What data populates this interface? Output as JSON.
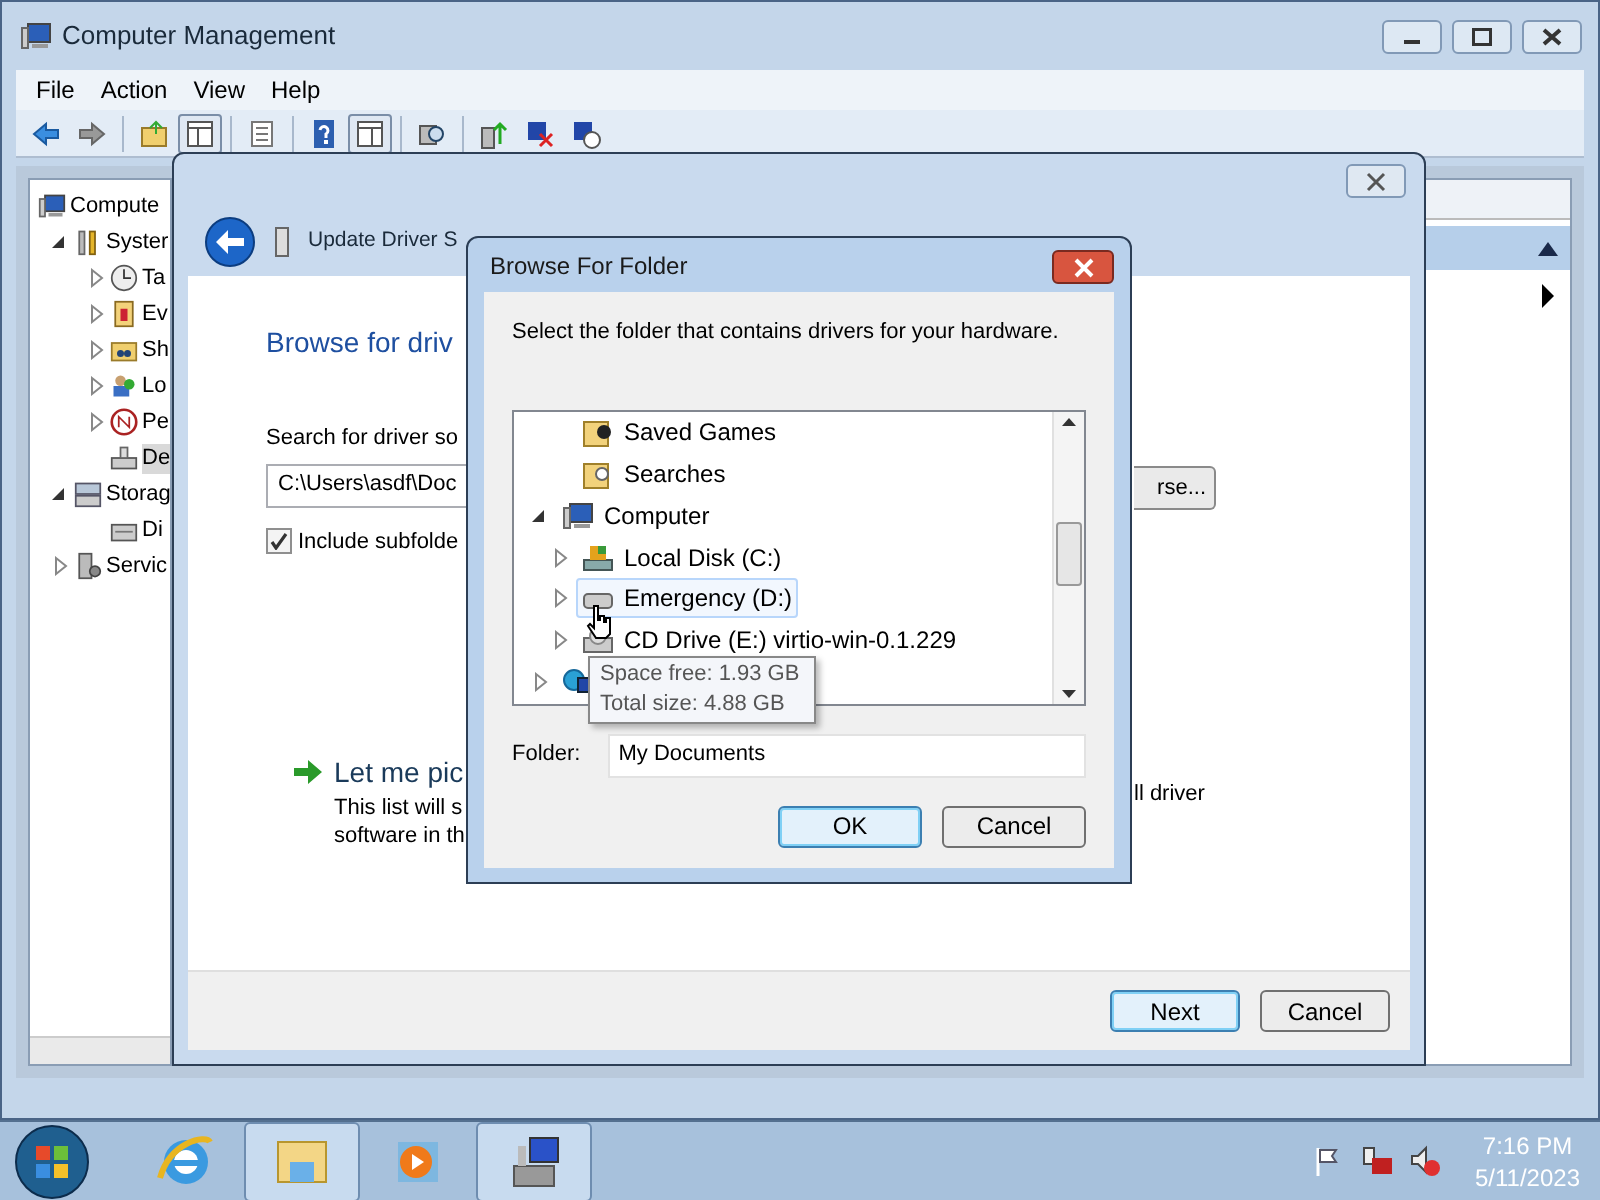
{
  "window": {
    "title": "Computer Management",
    "menu": [
      "File",
      "Action",
      "View",
      "Help"
    ]
  },
  "toolbar": [
    {
      "kind": "back"
    },
    {
      "kind": "forward"
    },
    {
      "kind": "sep"
    },
    {
      "kind": "up"
    },
    {
      "kind": "pane",
      "selected": true
    },
    {
      "kind": "sep"
    },
    {
      "kind": "list",
      "selected": false
    },
    {
      "kind": "sep"
    },
    {
      "kind": "help"
    },
    {
      "kind": "pane2",
      "selected": true
    },
    {
      "kind": "sep"
    },
    {
      "kind": "scan"
    },
    {
      "kind": "sep"
    },
    {
      "kind": "update"
    },
    {
      "kind": "remove"
    },
    {
      "kind": "install"
    }
  ],
  "tree": [
    {
      "label": "Compute",
      "kind": "computer",
      "selected": false,
      "children": [
        {
          "label": "Syster",
          "kind": "tools",
          "expanded": true,
          "selected": false,
          "children": [
            {
              "label": "Ta",
              "kind": "clock",
              "expanded": false,
              "selected": false
            },
            {
              "label": "Ev",
              "kind": "event",
              "expanded": false,
              "selected": false
            },
            {
              "label": "Sh",
              "kind": "share",
              "expanded": false,
              "selected": false
            },
            {
              "label": "Lo",
              "kind": "users",
              "expanded": false,
              "selected": false
            },
            {
              "label": "Pe",
              "kind": "perf",
              "expanded": false,
              "selected": false
            },
            {
              "label": "De",
              "kind": "device",
              "selected": true
            }
          ]
        },
        {
          "label": "Storag",
          "kind": "storage",
          "expanded": true,
          "selected": false,
          "children": [
            {
              "label": "Di",
              "kind": "disk",
              "selected": false
            }
          ]
        },
        {
          "label": "Servic",
          "kind": "services",
          "expanded": false,
          "selected": false
        }
      ]
    }
  ],
  "actions_panel": {
    "expanded": true
  },
  "wizard": {
    "title": "Update Driver S",
    "heading": "Browse for driv",
    "search_label": "Search for driver so",
    "path_value": "C:\\Users\\asdf\\Doc",
    "browse_button": "rse...",
    "include_subfolders": {
      "label": "Include subfolde",
      "checked": true
    },
    "pick_title": "Let me pic",
    "pick_desc": [
      "This list will s",
      "software in th"
    ],
    "pick_desc_tail": "ll driver",
    "buttons": [
      {
        "label": "Next",
        "default": true
      },
      {
        "label": "Cancel",
        "default": false
      }
    ]
  },
  "browse_dialog": {
    "title": "Browse For Folder",
    "prompt": "Select the folder that contains drivers for your hardware.",
    "tree": [
      {
        "label": "Saved Games",
        "kind": "saved-games",
        "hovered": false
      },
      {
        "label": "Searches",
        "kind": "searches",
        "hovered": false
      },
      {
        "label": "Computer",
        "kind": "computer",
        "expanded": true,
        "hovered": false,
        "children": [
          {
            "label": "Local Disk (C:)",
            "kind": "system-disk",
            "expanded": false,
            "hovered": false
          },
          {
            "label": "Emergency (D:)",
            "kind": "drive",
            "expanded": false,
            "hovered": true
          },
          {
            "label": "CD Drive (E:) virtio-win-0.1.229",
            "kind": "cd",
            "expanded": false,
            "hovered": false
          }
        ]
      },
      {
        "kind": "network",
        "expanded": false,
        "hovered": false
      }
    ],
    "tooltip": [
      "Space free: 1.93 GB",
      "Total size: 4.88 GB"
    ],
    "folder_label": "Folder:",
    "folder_value": "My Documents",
    "buttons": [
      {
        "label": "OK",
        "default": true
      },
      {
        "label": "Cancel",
        "default": false
      }
    ]
  },
  "taskbar": {
    "apps": [
      {
        "kind": "ie",
        "active": false
      },
      {
        "kind": "explorer",
        "active": true
      },
      {
        "kind": "media",
        "active": false
      },
      {
        "kind": "management",
        "active": true
      }
    ],
    "tray": [
      {
        "kind": "flag"
      },
      {
        "kind": "network-error"
      },
      {
        "kind": "speaker-error"
      }
    ],
    "time": "7:16 PM",
    "date": "5/11/2023"
  }
}
